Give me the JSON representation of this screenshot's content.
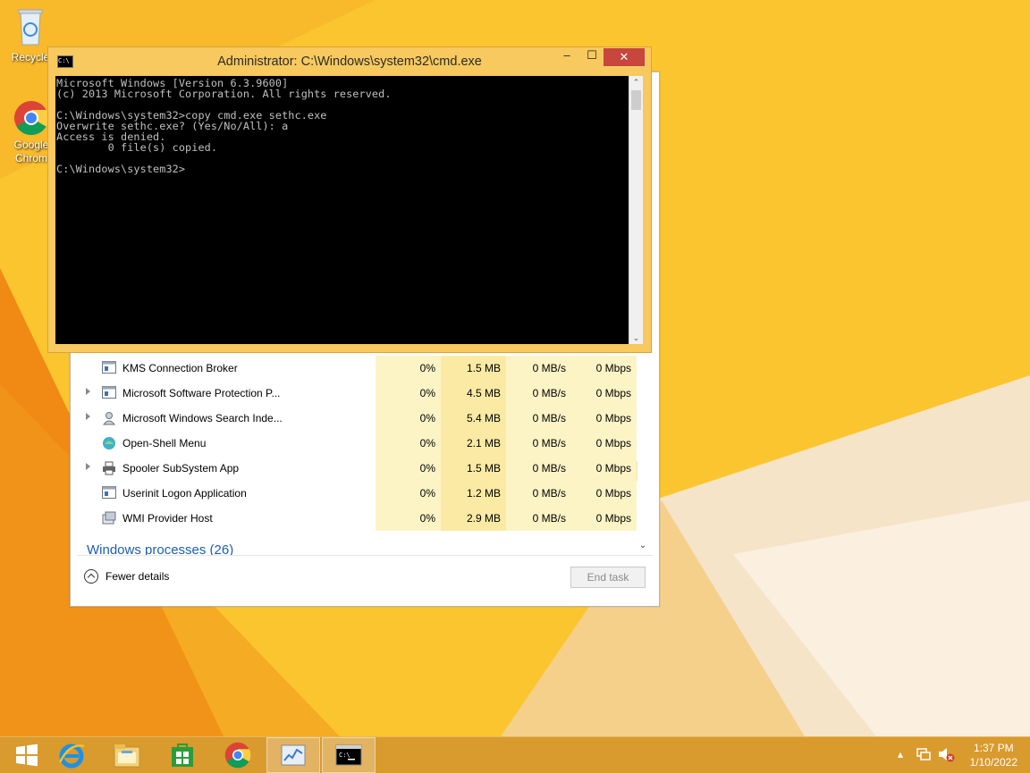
{
  "desktop": {
    "icons": [
      {
        "label": "Recycle"
      },
      {
        "label": "Google Chrom"
      }
    ]
  },
  "cmd": {
    "title": "Administrator: C:\\Windows\\system32\\cmd.exe",
    "icon_text": "C:\\",
    "lines": [
      "Microsoft Windows [Version 6.3.9600]",
      "(c) 2013 Microsoft Corporation. All rights reserved.",
      "",
      "C:\\Windows\\system32>copy cmd.exe sethc.exe",
      "Overwrite sethc.exe? (Yes/No/All): a",
      "Access is denied.",
      "        0 file(s) copied.",
      "",
      "C:\\Windows\\system32>"
    ],
    "minimize": "‒",
    "maximize": "☐",
    "close": "✕"
  },
  "taskmgr": {
    "processes": [
      {
        "name": "KMS Connection Broker",
        "cpu": "0%",
        "memory": "1.5 MB",
        "disk": "0 MB/s",
        "network": "0 Mbps",
        "expandable": false,
        "icon": "app-window-icon"
      },
      {
        "name": "Microsoft Software Protection P...",
        "cpu": "0%",
        "memory": "4.5 MB",
        "disk": "0 MB/s",
        "network": "0 Mbps",
        "expandable": true,
        "icon": "app-window-icon"
      },
      {
        "name": "Microsoft Windows Search Inde...",
        "cpu": "0%",
        "memory": "5.4 MB",
        "disk": "0 MB/s",
        "network": "0 Mbps",
        "expandable": true,
        "icon": "search-indexer-icon"
      },
      {
        "name": "Open-Shell Menu",
        "cpu": "0%",
        "memory": "2.1 MB",
        "disk": "0 MB/s",
        "network": "0 Mbps",
        "expandable": false,
        "icon": "shell-orb-icon"
      },
      {
        "name": "Spooler SubSystem App",
        "cpu": "0%",
        "memory": "1.5 MB",
        "disk": "0 MB/s",
        "network": "0 Mbps",
        "expandable": true,
        "icon": "printer-icon"
      },
      {
        "name": "Userinit Logon Application",
        "cpu": "0%",
        "memory": "1.2 MB",
        "disk": "0 MB/s",
        "network": "0 Mbps",
        "expandable": false,
        "icon": "app-window-icon"
      },
      {
        "name": "WMI Provider Host",
        "cpu": "0%",
        "memory": "2.9 MB",
        "disk": "0 MB/s",
        "network": "0 Mbps",
        "expandable": false,
        "icon": "wmi-icon"
      }
    ],
    "group_header": "Windows processes (26)",
    "fewer_details": "Fewer details",
    "end_task": "End task"
  },
  "taskbar": {
    "apps": [
      "start-icon",
      "internet-explorer-icon",
      "file-explorer-icon",
      "store-icon",
      "chrome-icon",
      "task-manager-icon",
      "cmd-icon"
    ],
    "time": "1:37 PM",
    "date": "1/10/2022"
  },
  "colors": {
    "desktop_orange": "#f5a623",
    "cmd_frame": "#f7c95e",
    "close_red": "#c7463e",
    "heat_yellow": "#fdf4c6",
    "link_blue": "#1d5fb0"
  }
}
